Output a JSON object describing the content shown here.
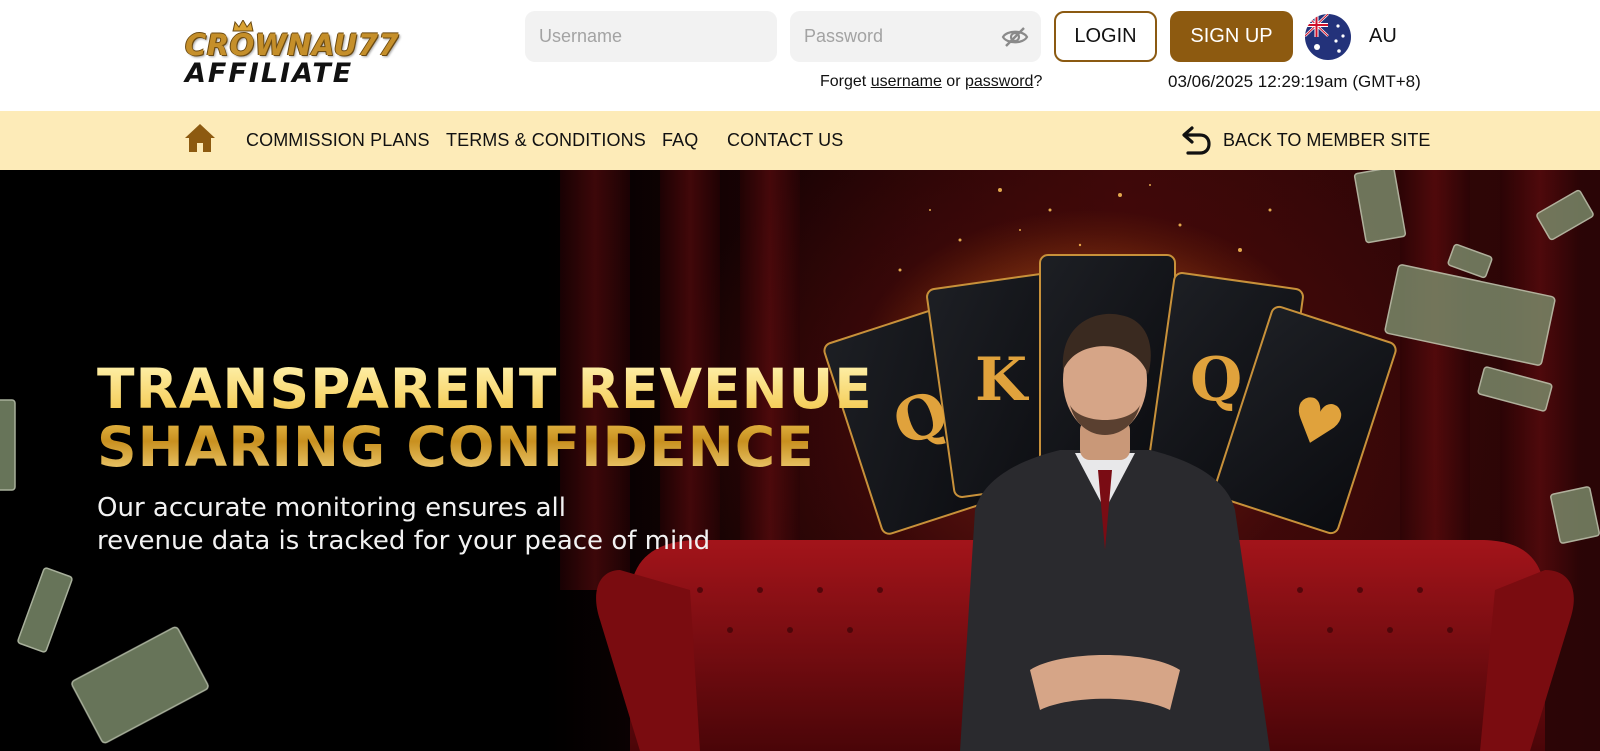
{
  "header": {
    "logo": {
      "brand": "CROWNAU77",
      "sub": "AFFILIATE"
    },
    "username_placeholder": "Username",
    "password_placeholder": "Password",
    "login_label": "LOGIN",
    "signup_label": "SIGN UP",
    "language": "AU",
    "forget": {
      "prefix": "Forget ",
      "username_link": "username",
      "middle": " or ",
      "password_link": "password",
      "suffix": "?"
    },
    "datetime": "03/06/2025 12:29:19am (GMT+8)"
  },
  "nav": {
    "items": [
      {
        "label": "COMMISSION PLANS"
      },
      {
        "label": "TERMS & CONDITIONS"
      },
      {
        "label": "FAQ"
      },
      {
        "label": "CONTACT US"
      }
    ],
    "back_label": "BACK TO MEMBER SITE",
    "icons": {
      "home": "home-icon",
      "back": "back-arrow-icon"
    }
  },
  "hero": {
    "title_line1": "TRANSPARENT REVENUE",
    "title_line2": "SHARING CONFIDENCE",
    "subtitle_line1": "Our accurate monitoring ensures all",
    "subtitle_line2": "revenue data is tracked for your peace of mind"
  },
  "colors": {
    "brand_brown": "#8d5a10",
    "nav_bg": "#fdebb8",
    "gold": "#f0c659",
    "input_bg": "#f2f2f2"
  }
}
